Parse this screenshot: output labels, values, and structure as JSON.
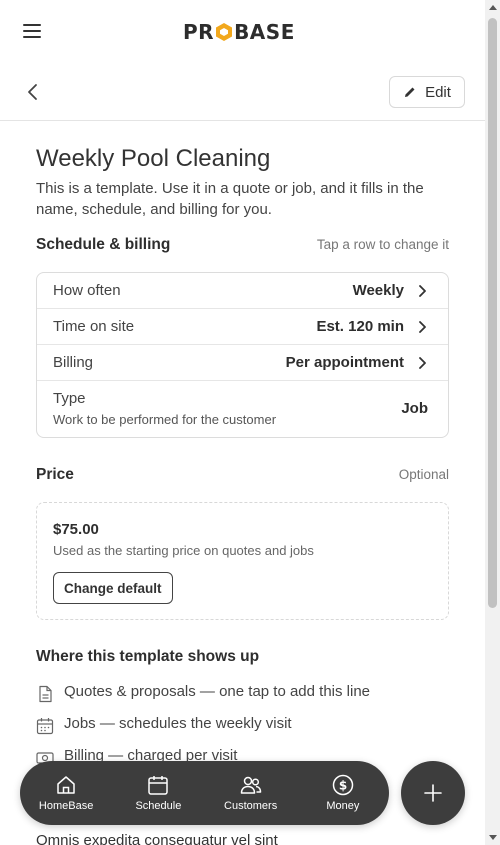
{
  "header": {
    "logo_text_left": "PR",
    "logo_text_right": "BASE",
    "logo_alt": "PROBASE"
  },
  "page_bar": {
    "edit_label": "Edit"
  },
  "page": {
    "title": "Weekly Pool Cleaning",
    "description": "This is a template. Use it in a quote or job, and it fills in the name, schedule, and billing for you."
  },
  "schedule_billing": {
    "title": "Schedule & billing",
    "hint": "Tap a row to change it",
    "rows": [
      {
        "label": "How often",
        "value": "Weekly"
      },
      {
        "label": "Time on site",
        "value": "Est. 120 min"
      },
      {
        "label": "Billing",
        "value": "Per appointment"
      }
    ],
    "type": {
      "label": "Type",
      "sublabel": "Work to be performed for the customer",
      "value": "Job"
    }
  },
  "price": {
    "title": "Price",
    "hint": "Optional",
    "amount": "$75.00",
    "sub": "Used as the starting price on quotes and jobs",
    "change_label": "Change default"
  },
  "usage": {
    "title": "Where this template shows up",
    "items": [
      {
        "icon": "document-icon",
        "text": "Quotes & proposals — one tap to add this line"
      },
      {
        "icon": "calendar-icon",
        "text": "Jobs — schedules the weekly visit"
      },
      {
        "icon": "cash-icon",
        "text": "Billing — charged per visit"
      }
    ]
  },
  "bottom_text": "Omnis expedita consequatur vel sint",
  "bottom_nav": {
    "items": [
      {
        "icon": "home-icon",
        "label": "HomeBase"
      },
      {
        "icon": "calendar-icon",
        "label": "Schedule"
      },
      {
        "icon": "people-icon",
        "label": "Customers"
      },
      {
        "icon": "dollar-icon",
        "label": "Money"
      }
    ],
    "fab_icon": "plus-icon"
  },
  "colors": {
    "nav_bg": "#3d3d3d",
    "logo_accent": "#f2a81d",
    "text": "#333333"
  }
}
